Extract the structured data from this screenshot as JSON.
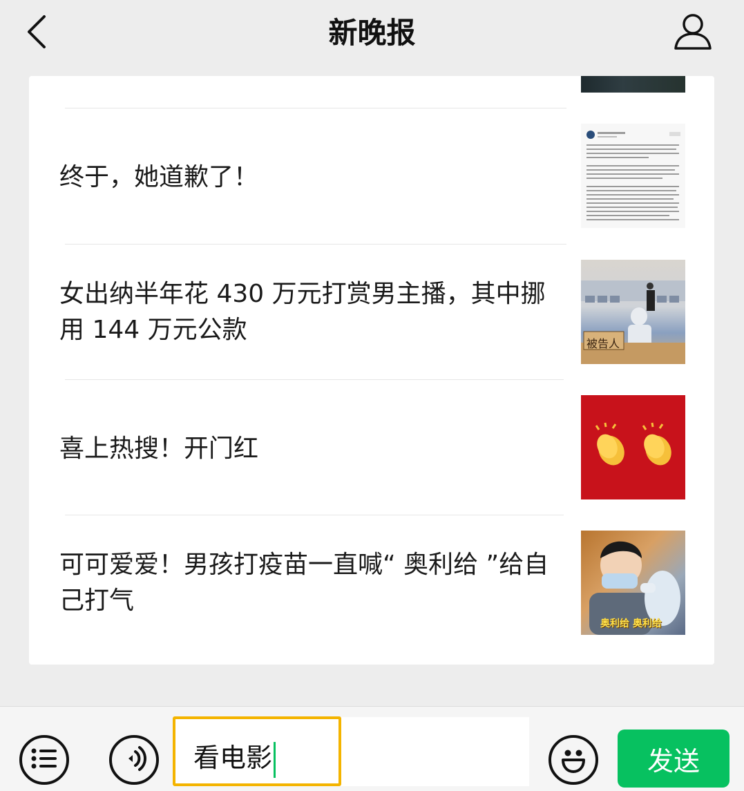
{
  "header": {
    "title": "新晚报",
    "back_icon": "chevron-left-icon",
    "profile_icon": "user-icon"
  },
  "feed": {
    "items": [
      {
        "title": "终于，她道歉了！",
        "thumbnail": "apology-post-screenshot"
      },
      {
        "title": "女出纳半年花 430 万元打赏男主播，其中挪用 144 万元公款",
        "thumbnail": "courtroom-defendant-photo",
        "thumb_caption": "被告人"
      },
      {
        "title": "喜上热搜！开门红",
        "thumbnail": "clapping-hands-red"
      },
      {
        "title": "可可爱爱！男孩打疫苗一直喊“ 奥利给 ”给自己打气",
        "thumbnail": "boy-vaccine-photo",
        "thumb_caption": "奥利给 奥利给"
      }
    ]
  },
  "input_bar": {
    "menu_icon": "list-icon",
    "voice_icon": "voice-icon",
    "emoji_icon": "emoji-icon",
    "input_value": "看电影",
    "send_label": "发送"
  },
  "colors": {
    "background": "#ededed",
    "card": "#ffffff",
    "send_green": "#07c160",
    "highlight": "#f4b400"
  }
}
